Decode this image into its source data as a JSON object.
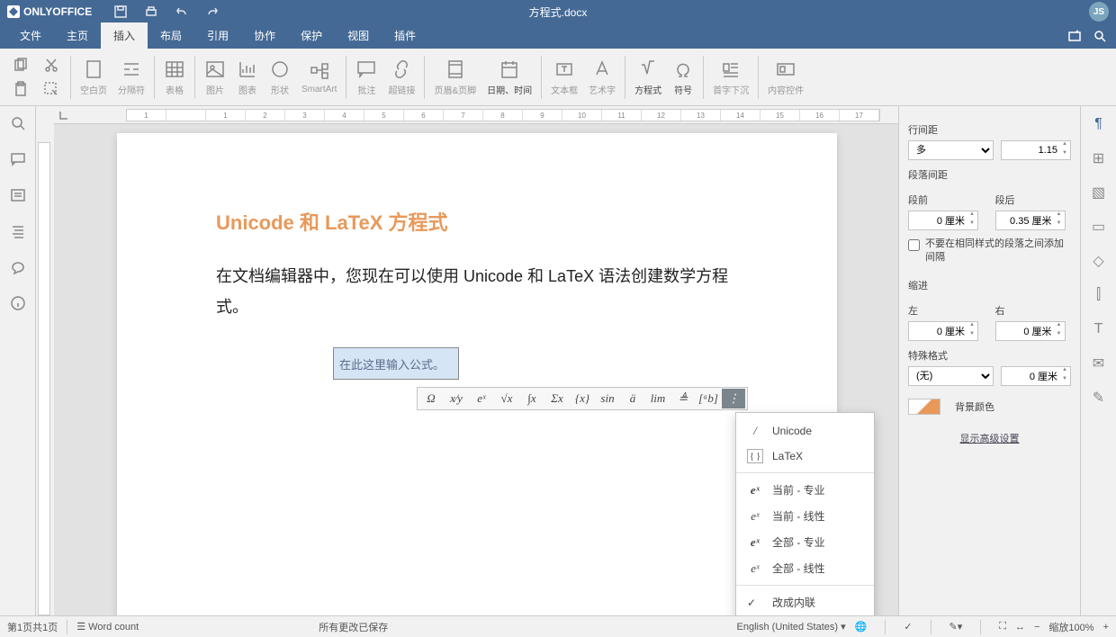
{
  "app": {
    "name": "ONLYOFFICE",
    "doc_title": "方程式.docx",
    "user": "JS"
  },
  "menu": {
    "items": [
      "文件",
      "主页",
      "插入",
      "布局",
      "引用",
      "协作",
      "保护",
      "视图",
      "插件"
    ],
    "active": 2
  },
  "ribbon": {
    "items": [
      {
        "label": "空白页"
      },
      {
        "label": "分隔符"
      },
      {
        "label": "表格"
      },
      {
        "label": "图片"
      },
      {
        "label": "图表"
      },
      {
        "label": "形状"
      },
      {
        "label": "SmartArt"
      },
      {
        "label": "批注"
      },
      {
        "label": "超链接"
      },
      {
        "label": "页眉&页脚"
      },
      {
        "label": "日期、时间"
      },
      {
        "label": "文本框"
      },
      {
        "label": "艺术字"
      },
      {
        "label": "方程式"
      },
      {
        "label": "符号"
      },
      {
        "label": "首字下沉"
      },
      {
        "label": "内容控件"
      }
    ]
  },
  "ruler": {
    "ticks": [
      "1",
      "",
      "1",
      "2",
      "3",
      "4",
      "5",
      "6",
      "7",
      "8",
      "9",
      "10",
      "11",
      "12",
      "13",
      "14",
      "15",
      "16",
      "17"
    ]
  },
  "doc": {
    "heading": "Unicode 和 LaTeX 方程式",
    "body": "在文档编辑器中，您现在可以使用 Unicode 和 LaTeX 语法创建数学方程式。",
    "eq_placeholder": "在此这里输入公式。"
  },
  "eq_toolbar": {
    "items": [
      "Ω",
      "x⁄y",
      "eˣ",
      "√x",
      "∫x",
      "Σx",
      "{x}",
      "sin",
      "ä",
      "lim",
      "≜",
      "[ᵃb]",
      "⋮"
    ]
  },
  "eq_menu": {
    "items": [
      {
        "icon": "/",
        "label": "Unicode"
      },
      {
        "icon": "{ }",
        "label": "LaTeX",
        "box": true
      },
      {
        "sep": true
      },
      {
        "icon": "eˣ",
        "label": "当前 - 专业",
        "bold": true
      },
      {
        "icon": "eˣ",
        "label": "当前 - 线性"
      },
      {
        "icon": "eˣ",
        "label": "全部 - 专业",
        "bold": true
      },
      {
        "icon": "eˣ",
        "label": "全部 - 线性"
      },
      {
        "sep": true
      },
      {
        "check": true,
        "label": "改成内联"
      }
    ]
  },
  "right_panel": {
    "line_spacing": {
      "label": "行间距",
      "mode": "多",
      "value": "1.15"
    },
    "para_spacing": {
      "label": "段落间距",
      "before_label": "段前",
      "before": "0 厘米",
      "after_label": "段后",
      "after": "0.35 厘米"
    },
    "no_space": "不要在相同样式的段落之间添加间隔",
    "indent": {
      "label": "缩进",
      "left_label": "左",
      "left": "0 厘米",
      "right_label": "右",
      "right": "0 厘米"
    },
    "special": {
      "label": "特殊格式",
      "mode": "(无)",
      "value": "0 厘米"
    },
    "bg_label": "背景颜色",
    "advanced": "显示高级设置"
  },
  "status": {
    "page": "第1页共1页",
    "wordcount": "Word count",
    "saved": "所有更改已保存",
    "lang": "English (United States)",
    "zoom": "缩放100%"
  }
}
